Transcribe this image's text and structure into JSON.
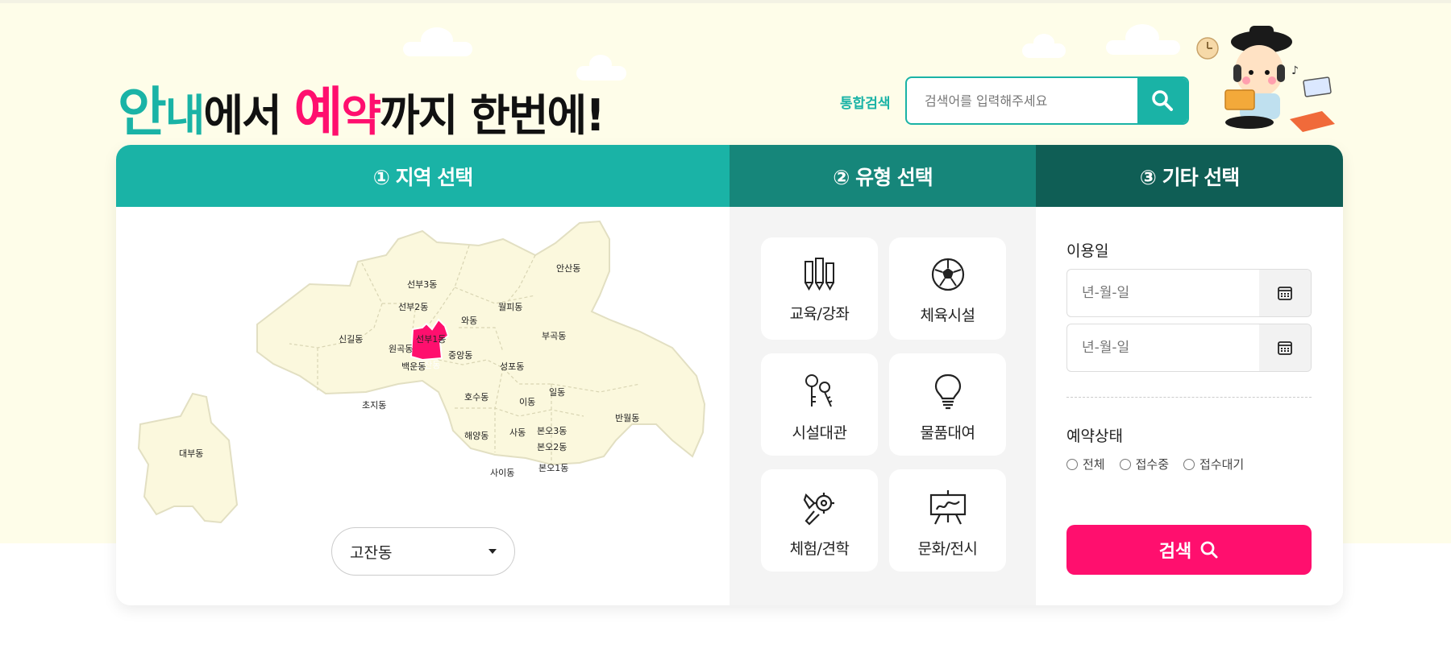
{
  "headline": {
    "part1a": "안",
    "part1b": "내",
    "part2": "에서 ",
    "part3a": "예",
    "part3b": "약",
    "part4": "까지 한번에!"
  },
  "search": {
    "label": "통합검색",
    "placeholder": "검색어를 입력해주세요"
  },
  "tabs": [
    {
      "label": "① 지역 선택"
    },
    {
      "label": "② 유형 선택"
    },
    {
      "label": "③ 기타 선택"
    }
  ],
  "map": {
    "highlighted": "고잔동",
    "dong_labels": [
      "선부3동",
      "안산동",
      "선부2동",
      "월피동",
      "와동",
      "신길동",
      "선부1동",
      "원곡동",
      "부곡동",
      "고잔동",
      "중앙동",
      "백운동",
      "성포동",
      "일동",
      "초지동",
      "호수동",
      "이동",
      "반월동",
      "대부동",
      "해양동",
      "사동",
      "본오3동",
      "본오2동",
      "사이동",
      "본오1동"
    ],
    "selected_dong": "고잔동"
  },
  "types": [
    {
      "label": "교육/강좌",
      "icon": "pencils-icon"
    },
    {
      "label": "체육시설",
      "icon": "soccer-ball-icon"
    },
    {
      "label": "시설대관",
      "icon": "keys-icon"
    },
    {
      "label": "물품대여",
      "icon": "lightbulb-icon"
    },
    {
      "label": "체험/견학",
      "icon": "tools-icon"
    },
    {
      "label": "문화/전시",
      "icon": "easel-icon"
    }
  ],
  "etc": {
    "date_label": "이용일",
    "date_placeholder_1": "년-월-일",
    "date_placeholder_2": "년-월-일",
    "status_label": "예약상태",
    "status_options": [
      "전체",
      "접수중",
      "접수대기"
    ],
    "submit_label": "검색"
  },
  "colors": {
    "teal": "#1ab3a6",
    "teal_dark": "#16867a",
    "teal_darker": "#0f5e55",
    "pink": "#ff0f6e",
    "cream": "#fefde9"
  }
}
